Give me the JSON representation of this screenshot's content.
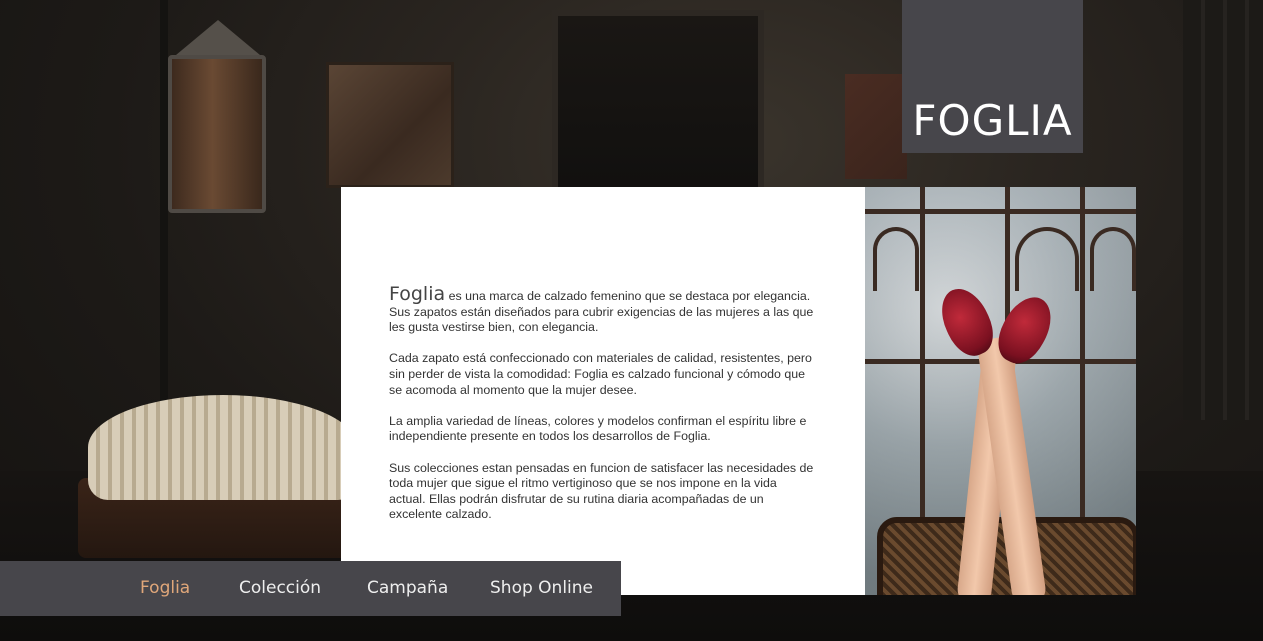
{
  "logo": {
    "text": "FOGLIA"
  },
  "nav": {
    "items": [
      {
        "label": "Foglia",
        "active": true
      },
      {
        "label": "Colección",
        "active": false
      },
      {
        "label": "Campaña",
        "active": false
      },
      {
        "label": "Shop Online",
        "active": false
      }
    ]
  },
  "content": {
    "brand": "Foglia",
    "intro_rest": " es una marca de calzado femenino que se destaca por elegancia. Sus zapatos están diseñados para cubrir exigencias de las mujeres a las que les gusta vestirse bien, con elegancia.",
    "paragraph2": "Cada zapato está confeccionado con materiales de calidad, resistentes, pero sin perder de vista la comodidad: Foglia es calzado funcional y cómodo que se acomoda al momento que la mujer desee.",
    "paragraph3": "La amplia variedad de líneas, colores y modelos confirman el espíritu libre e independiente presente en todos los desarrollos de Foglia.",
    "paragraph4": "Sus colecciones estan pensadas en funcion de satisfacer las necesidades de toda mujer que sigue el ritmo vertiginoso que se nos impone en la vida actual. Ellas podrán disfrutar de su rutina diaria acompañadas de un excelente calzado."
  },
  "colors": {
    "logo_bg": "#47464b",
    "nav_bg": "#47464b",
    "nav_active": "#e0a77a",
    "nav_text": "#eeeeee",
    "panel_bg": "#ffffff"
  }
}
